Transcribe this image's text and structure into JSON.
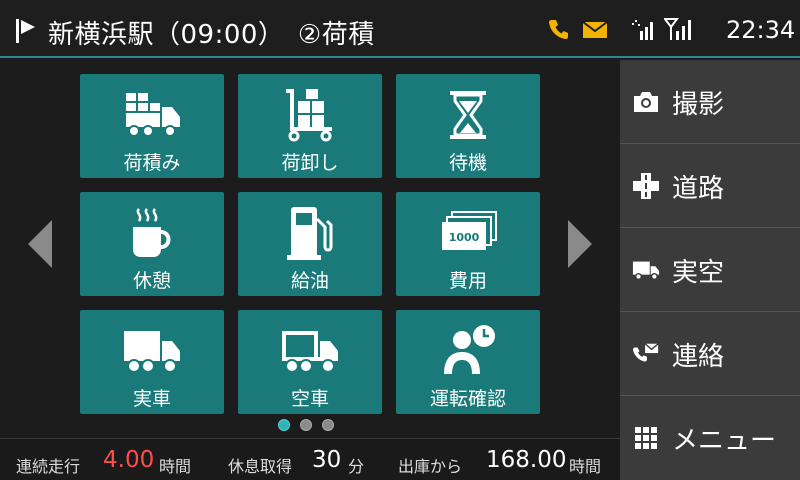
{
  "header": {
    "title": "新横浜駅（09:00）　②荷積",
    "time": "22:34"
  },
  "tiles": [
    {
      "label": "荷積み",
      "icon": "loading-truck-icon"
    },
    {
      "label": "荷卸し",
      "icon": "hand-cart-icon"
    },
    {
      "label": "待機",
      "icon": "hourglass-icon"
    },
    {
      "label": "休憩",
      "icon": "coffee-cup-icon"
    },
    {
      "label": "給油",
      "icon": "fuel-pump-icon"
    },
    {
      "label": "費用",
      "icon": "banknotes-icon"
    },
    {
      "label": "実車",
      "icon": "loaded-truck-icon"
    },
    {
      "label": "空車",
      "icon": "empty-truck-icon"
    },
    {
      "label": "運転確認",
      "icon": "driver-clock-icon"
    }
  ],
  "pagination": {
    "pages": 3,
    "current": 1
  },
  "bottom": {
    "continuous_drive_label": "連続走行",
    "continuous_drive_value": "4.00",
    "continuous_drive_unit": "時間",
    "rest_label": "休息取得",
    "rest_value": "30",
    "rest_unit": "分",
    "since_depart_label": "出庫から",
    "since_depart_value": "168.00",
    "since_depart_unit": "時間"
  },
  "side_menu": [
    {
      "label": "撮影",
      "icon": "camera-icon"
    },
    {
      "label": "道路",
      "icon": "road-icon"
    },
    {
      "label": "実空",
      "icon": "truck-icon"
    },
    {
      "label": "連絡",
      "icon": "phone-mail-icon"
    },
    {
      "label": "メニュー",
      "icon": "grid-menu-icon"
    }
  ],
  "colors": {
    "tile": "#1a7a7a",
    "accent_value": "#ff4d4d",
    "phone_icon": "#f2b400",
    "mail_icon": "#f2b400"
  }
}
